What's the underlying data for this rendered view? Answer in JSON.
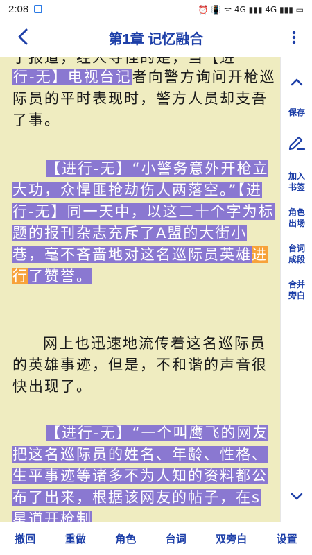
{
  "status_bar": {
    "time": "2:08",
    "right_text": "⏰ 📳 ᯤ 4G ▮▮▮ 4G ▮▮▮ ▭"
  },
  "header": {
    "title": "第1章 记忆融合"
  },
  "reader": {
    "line_top": "了报道，经人寻怪的是，当【进",
    "p1": {
      "hl_start": "行-无】电视台记",
      "rest": "者向警方询问开枪巡际员的平时表现时，警方人员却支吾了事。"
    },
    "p2": {
      "seg1": "【进行-无】“小警务意外开枪立大功，众悍匪抢劫伤人两落空。”【进行-无】同一天中，以这二十个字为标题的报刊杂志充斥了A盟的大街小巷，毫不吝啬地对这名巡际员英雄",
      "orange": "进行",
      "seg2": "了赞誉。"
    },
    "p3": "网上也迅速地流传着这名巡际员的英雄事迹，但是，不和谐的声音很快出现了。",
    "p4": "【进行-无】“一个叫鹰飞的网友把这名巡际员的姓名、年龄、性格、生平事迹等诸多不为人知的资料都公布了出来，根据该网友的帖子，在s星道开枪制"
  },
  "side_panel": {
    "save": "保存",
    "add_bookmark": "加入书签",
    "role_appear": "角色出场",
    "dialog_segment": "台词成段",
    "merge_aside": "合并旁白"
  },
  "bottom_bar": {
    "undo": "撤回",
    "redo": "重做",
    "role": "角色",
    "dialog": "台词",
    "double_aside": "双旁白",
    "settings": "设置"
  },
  "colors": {
    "accent": "#1d3fa8",
    "highlight": "#8a78d1",
    "highlight_orange": "#f7a23a",
    "paper": "#efecc0"
  }
}
